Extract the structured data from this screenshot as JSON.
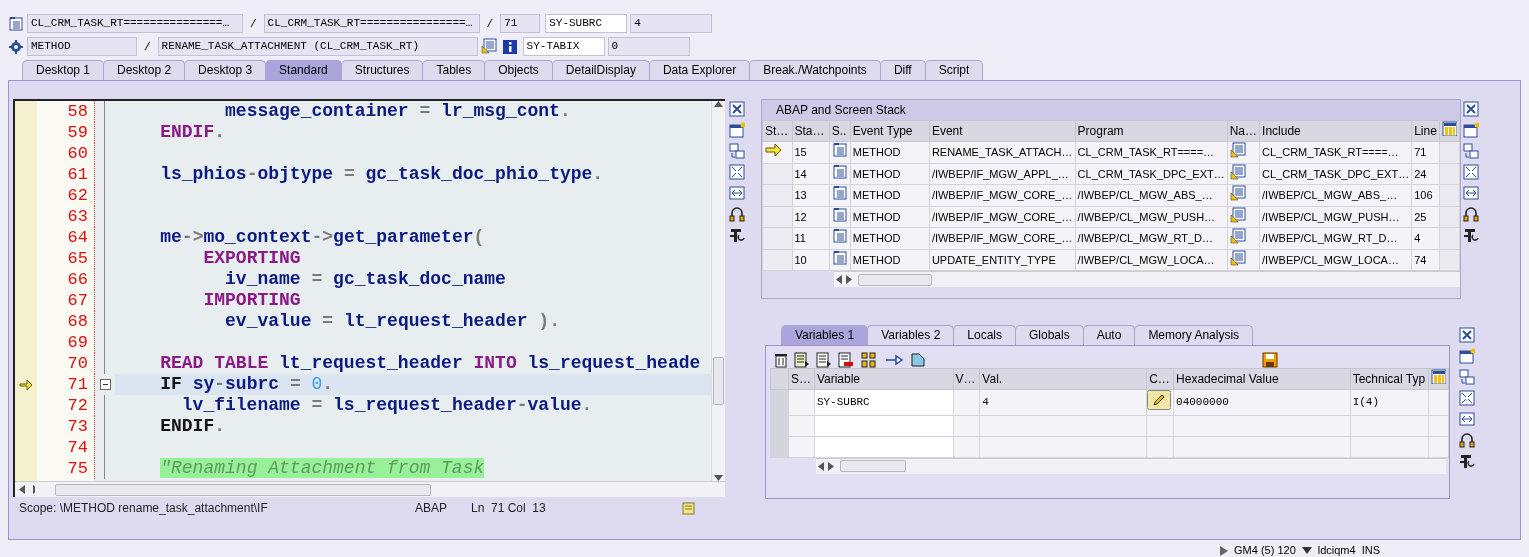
{
  "header": {
    "top_row": [
      {
        "kind": "object",
        "text": "CL_CRM_TASK_RT===============…"
      },
      {
        "kind": "sep",
        "text": "/"
      },
      {
        "kind": "object",
        "text": "CL_CRM_TASK_RT================…"
      },
      {
        "kind": "sep",
        "text": "/"
      },
      {
        "kind": "line",
        "text": "71"
      },
      {
        "kind": "sysvar_name",
        "text": "SY-SUBRC"
      },
      {
        "kind": "sysvar_value",
        "text": "4"
      }
    ],
    "bottom_row": [
      {
        "kind": "event_type",
        "text": "METHOD"
      },
      {
        "kind": "sep",
        "text": "/"
      },
      {
        "kind": "event",
        "text": "RENAME_TASK_ATTACHMENT (CL_CRM_TASK_RT)"
      },
      {
        "kind": "sysvar_name",
        "text": "SY-TABIX"
      },
      {
        "kind": "sysvar_value",
        "text": "0"
      }
    ]
  },
  "tabs": [
    {
      "label": "Desktop 1",
      "selected": false
    },
    {
      "label": "Desktop 2",
      "selected": false
    },
    {
      "label": "Desktop 3",
      "selected": false
    },
    {
      "label": "Standard",
      "selected": true
    },
    {
      "label": "Structures",
      "selected": false
    },
    {
      "label": "Tables",
      "selected": false
    },
    {
      "label": "Objects",
      "selected": false
    },
    {
      "label": "DetailDisplay",
      "selected": false
    },
    {
      "label": "Data Explorer",
      "selected": false
    },
    {
      "label": "Break./Watchpoints",
      "selected": false
    },
    {
      "label": "Diff",
      "selected": false
    },
    {
      "label": "Script",
      "selected": false
    }
  ],
  "editor": {
    "lines": [
      {
        "number": "58",
        "current": false,
        "tokens": [
          {
            "kind": "id",
            "text": "          message_container"
          },
          {
            "kind": "op",
            "text": " = "
          },
          {
            "kind": "id",
            "text": "lr_msg_cont"
          },
          {
            "kind": "op",
            "text": "."
          }
        ]
      },
      {
        "number": "59",
        "current": false,
        "tokens": [
          {
            "kind": "kw",
            "text": "    ENDIF"
          },
          {
            "kind": "op",
            "text": "."
          }
        ]
      },
      {
        "number": "60",
        "current": false
      },
      {
        "number": "61",
        "current": false,
        "tokens": [
          {
            "kind": "id",
            "text": "    ls_phios"
          },
          {
            "kind": "op",
            "text": "-"
          },
          {
            "kind": "id",
            "text": "objtype"
          },
          {
            "kind": "op",
            "text": " = "
          },
          {
            "kind": "id",
            "text": "gc_task_doc_phio_type"
          },
          {
            "kind": "op",
            "text": "."
          }
        ]
      },
      {
        "number": "62",
        "current": false
      },
      {
        "number": "63",
        "current": false
      },
      {
        "number": "64",
        "current": false,
        "tokens": [
          {
            "kind": "id",
            "text": "    me"
          },
          {
            "kind": "op",
            "text": "->"
          },
          {
            "kind": "id",
            "text": "mo_context"
          },
          {
            "kind": "op",
            "text": "->"
          },
          {
            "kind": "id",
            "text": "get_parameter"
          },
          {
            "kind": "op",
            "text": "("
          }
        ]
      },
      {
        "number": "65",
        "current": false,
        "tokens": [
          {
            "kind": "kw",
            "text": "        EXPORTING"
          }
        ]
      },
      {
        "number": "66",
        "current": false,
        "tokens": [
          {
            "kind": "id",
            "text": "          iv_name"
          },
          {
            "kind": "op",
            "text": " = "
          },
          {
            "kind": "id",
            "text": "gc_task_doc_name"
          }
        ]
      },
      {
        "number": "67",
        "current": false,
        "tokens": [
          {
            "kind": "kw",
            "text": "        IMPORTING"
          }
        ]
      },
      {
        "number": "68",
        "current": false,
        "tokens": [
          {
            "kind": "id",
            "text": "          ev_value"
          },
          {
            "kind": "op",
            "text": " = "
          },
          {
            "kind": "id",
            "text": "lt_request_header"
          },
          {
            "kind": "op",
            "text": " )."
          }
        ]
      },
      {
        "number": "69",
        "current": false
      },
      {
        "number": "70",
        "current": false,
        "tokens": [
          {
            "kind": "kw",
            "text": "    READ TABLE "
          },
          {
            "kind": "id",
            "text": "lt_request_header "
          },
          {
            "kind": "kw",
            "text": "INTO "
          },
          {
            "kind": "id",
            "text": "ls_request_heade"
          }
        ]
      },
      {
        "number": "71",
        "current": true,
        "tokens": [
          {
            "kind": "block",
            "text": "    IF "
          },
          {
            "kind": "id",
            "text": "sy"
          },
          {
            "kind": "op",
            "text": "-"
          },
          {
            "kind": "id",
            "text": "subrc"
          },
          {
            "kind": "op",
            "text": " = "
          },
          {
            "kind": "num",
            "text": "0"
          },
          {
            "kind": "op",
            "text": "."
          }
        ]
      },
      {
        "number": "72",
        "current": false,
        "tokens": [
          {
            "kind": "id",
            "text": "      lv_filename"
          },
          {
            "kind": "op",
            "text": " = "
          },
          {
            "kind": "id",
            "text": "ls_request_header"
          },
          {
            "kind": "op",
            "text": "-"
          },
          {
            "kind": "id",
            "text": "value"
          },
          {
            "kind": "op",
            "text": "."
          }
        ]
      },
      {
        "number": "73",
        "current": false,
        "tokens": [
          {
            "kind": "block",
            "text": "    ENDIF"
          },
          {
            "kind": "op",
            "text": "."
          }
        ]
      },
      {
        "number": "74",
        "current": false
      },
      {
        "number": "75",
        "current": false,
        "tokens": [
          {
            "kind": "comment",
            "text": "    \"Renaming Attachment from Task"
          }
        ]
      }
    ],
    "status": {
      "scope": "Scope: \\METHOD rename_task_attachment\\IF",
      "language": "ABAP",
      "position": "Ln  71 Col  13"
    }
  },
  "stack": {
    "title": "ABAP and Screen Stack",
    "columns": [
      "St…",
      "Sta…",
      "S..",
      "Event Type",
      "Event",
      "Program",
      "Na…",
      "Include",
      "Line"
    ],
    "rows": [
      {
        "selected": true,
        "number": "15",
        "event_type": "METHOD",
        "event": "RENAME_TASK_ATTACH…",
        "program": "CL_CRM_TASK_RT====…",
        "include": "CL_CRM_TASK_RT====…",
        "line": "71"
      },
      {
        "selected": false,
        "number": "14",
        "event_type": "METHOD",
        "event": "/IWBEP/IF_MGW_APPL_…",
        "program": "CL_CRM_TASK_DPC_EXT…",
        "include": "CL_CRM_TASK_DPC_EXT…",
        "line": "24"
      },
      {
        "selected": false,
        "number": "13",
        "event_type": "METHOD",
        "event": "/IWBEP/IF_MGW_CORE_…",
        "program": "/IWBEP/CL_MGW_ABS_…",
        "include": "/IWBEP/CL_MGW_ABS_…",
        "line": "106"
      },
      {
        "selected": false,
        "number": "12",
        "event_type": "METHOD",
        "event": "/IWBEP/IF_MGW_CORE_…",
        "program": "/IWBEP/CL_MGW_PUSH…",
        "include": "/IWBEP/CL_MGW_PUSH…",
        "line": "25"
      },
      {
        "selected": false,
        "number": "11",
        "event_type": "METHOD",
        "event": "/IWBEP/IF_MGW_CORE_…",
        "program": "/IWBEP/CL_MGW_RT_D…",
        "include": "/IWBEP/CL_MGW_RT_D…",
        "line": "4"
      },
      {
        "selected": false,
        "number": "10",
        "event_type": "METHOD",
        "event": "UPDATE_ENTITY_TYPE",
        "program": "/IWBEP/CL_MGW_LOCA…",
        "include": "/IWBEP/CL_MGW_LOCA…",
        "line": "74"
      }
    ]
  },
  "variables": {
    "tabs": [
      {
        "label": "Variables 1",
        "selected": true
      },
      {
        "label": "Variables 2",
        "selected": false
      },
      {
        "label": "Locals",
        "selected": false
      },
      {
        "label": "Globals",
        "selected": false
      },
      {
        "label": "Auto",
        "selected": false
      },
      {
        "label": "Memory Analysis",
        "selected": false
      }
    ],
    "columns": [
      "S…",
      "Variable",
      "V…",
      "Val.",
      "C…",
      "Hexadecimal Value",
      "Technical Typ"
    ],
    "rows": [
      {
        "variable": "SY-SUBRC",
        "value": "4",
        "hex": "04000000",
        "type": "I(4)"
      }
    ]
  },
  "status_bar": {
    "system": "GM4 (5) 120",
    "user": "ldciqm4",
    "mode": "INS"
  }
}
